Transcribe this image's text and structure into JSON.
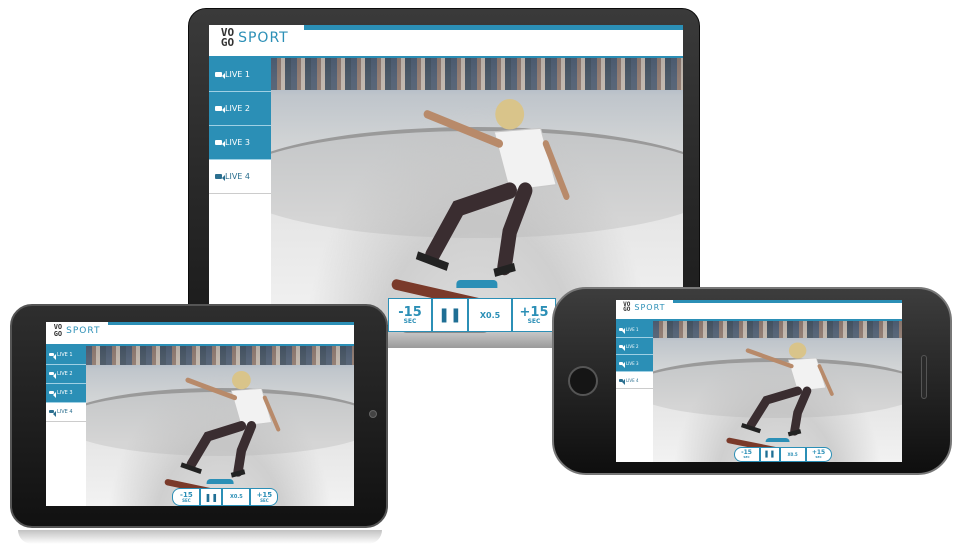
{
  "app": {
    "logo_letters": [
      "V",
      "O",
      "G",
      "O"
    ],
    "title": "SPORT",
    "accent_color": "#2b8fb6"
  },
  "sidebar": {
    "items": [
      {
        "label": "LIVE 1",
        "active": true
      },
      {
        "label": "LIVE 2",
        "active": true
      },
      {
        "label": "LIVE 3",
        "active": true
      },
      {
        "label": "LIVE 4",
        "active": false
      }
    ]
  },
  "player": {
    "rewind_label": "-15",
    "rewind_unit": "SEC",
    "pause_icon": "pause-icon",
    "speed_label": "X0.5",
    "forward_label": "+15",
    "forward_unit": "SEC"
  },
  "devices": [
    "laptop",
    "tablet",
    "phone"
  ]
}
